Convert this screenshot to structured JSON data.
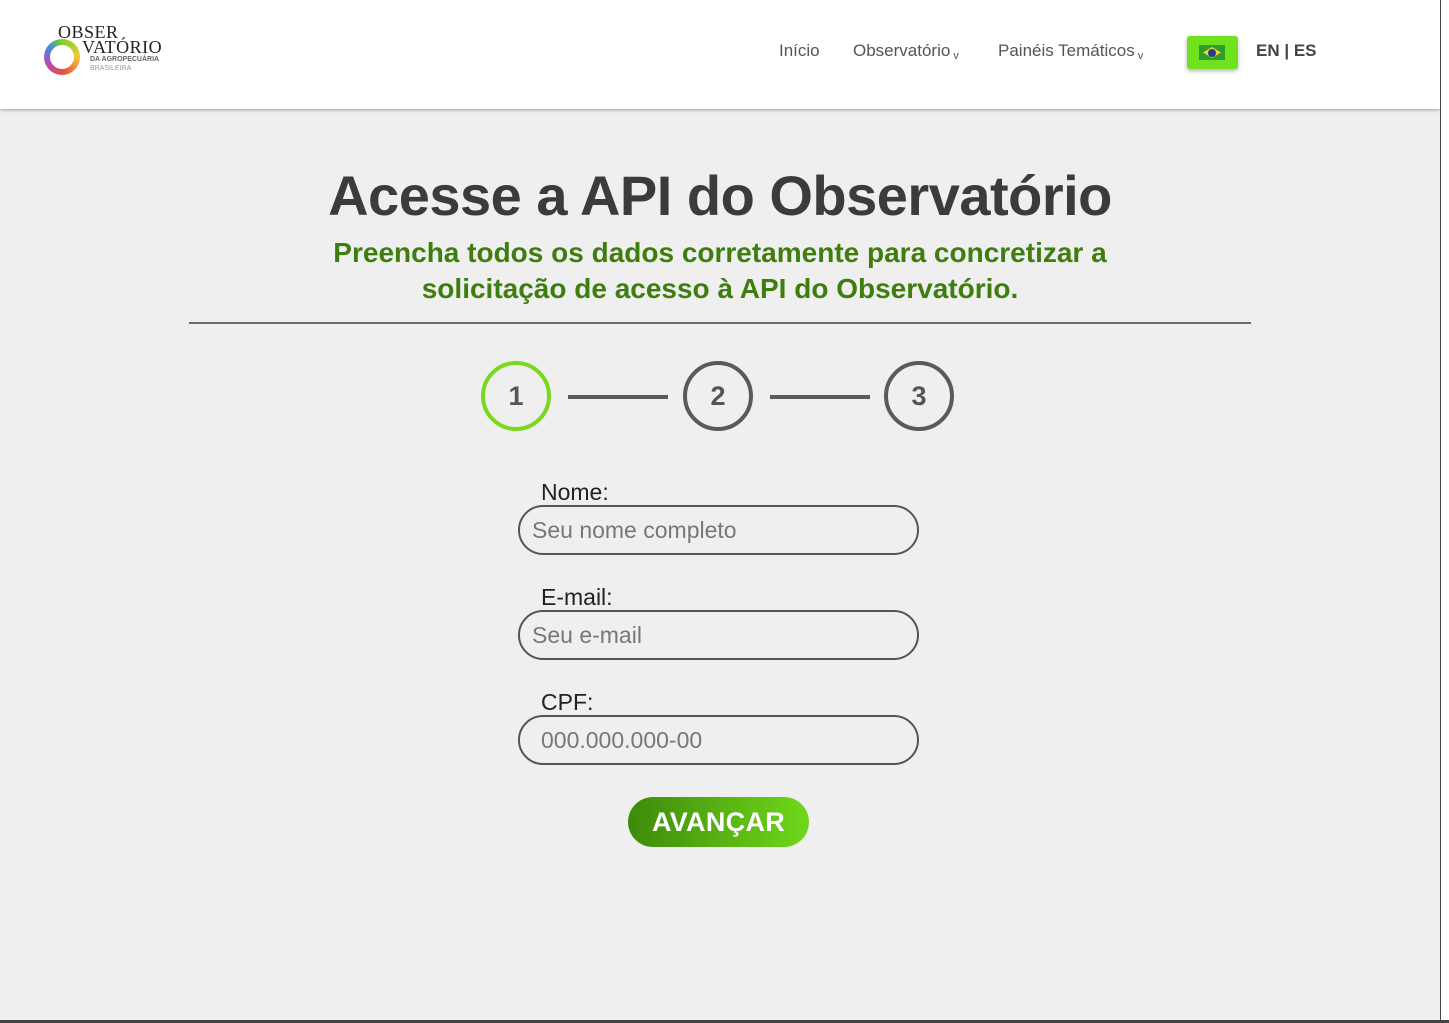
{
  "header": {
    "logo": {
      "line1": "OBSER",
      "line2": "VATÓRIO",
      "line3": "DA AGROPECUÁRIA",
      "line4": "BRASILEIRA"
    },
    "nav": {
      "home": "Início",
      "observatorio": "Observatório",
      "paineis": "Painéis Temáticos",
      "chevron": "v"
    },
    "language_flag_icon": "brazil-flag-icon",
    "language_switch": "EN | ES",
    "accent_color": "#6ee31d"
  },
  "main": {
    "title": "Acesse a API do Observatório",
    "subtitle": "Preencha todos os dados corretamente para concretizar a solicitação de acesso à API do Observatório.",
    "stepper": {
      "steps": [
        "1",
        "2",
        "3"
      ],
      "active_step": "1",
      "active_color": "#7ad81f"
    },
    "form": {
      "name_label": "Nome:",
      "name_placeholder": "Seu nome completo",
      "email_label": "E-mail:",
      "email_placeholder": "Seu e-mail",
      "cpf_label": "CPF:",
      "cpf_placeholder": "000.000.000-00",
      "submit_label": "AVANÇAR",
      "submit_color": "#4a9e10"
    }
  }
}
